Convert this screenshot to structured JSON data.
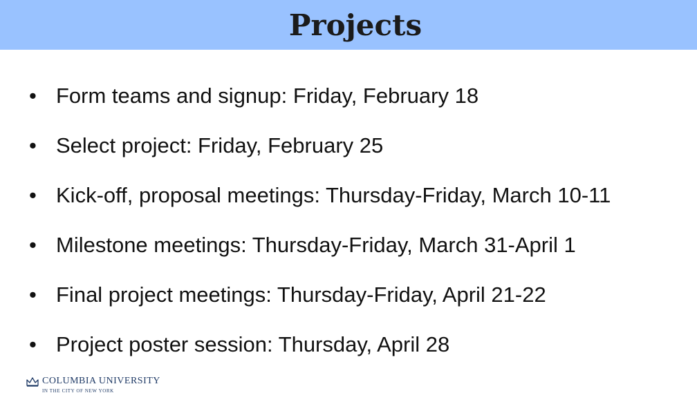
{
  "slide": {
    "title": "Projects",
    "bullets": [
      {
        "symbol": "•",
        "text": "Form teams and signup: Friday, February 18"
      },
      {
        "symbol": "•",
        "text": "Select project: Friday, February 25"
      },
      {
        "symbol": "•",
        "text": "Kick-off, proposal meetings: Thursday-Friday, March 10-11"
      },
      {
        "symbol": "•",
        "text": "Milestone meetings: Thursday-Friday, March 31-April 1"
      },
      {
        "symbol": "•",
        "text": "Final project meetings: Thursday-Friday, April 21-22"
      },
      {
        "symbol": "•",
        "text": "Project poster session: Thursday, April 28"
      }
    ]
  },
  "footer": {
    "logo_name": "COLUMBIA UNIVERSITY",
    "logo_sub": "IN THE CITY OF NEW YORK",
    "logo_icon": "crown-icon"
  },
  "colors": {
    "title_bar": "#99c2ff",
    "text": "#111111",
    "logo": "#1f3a66"
  }
}
